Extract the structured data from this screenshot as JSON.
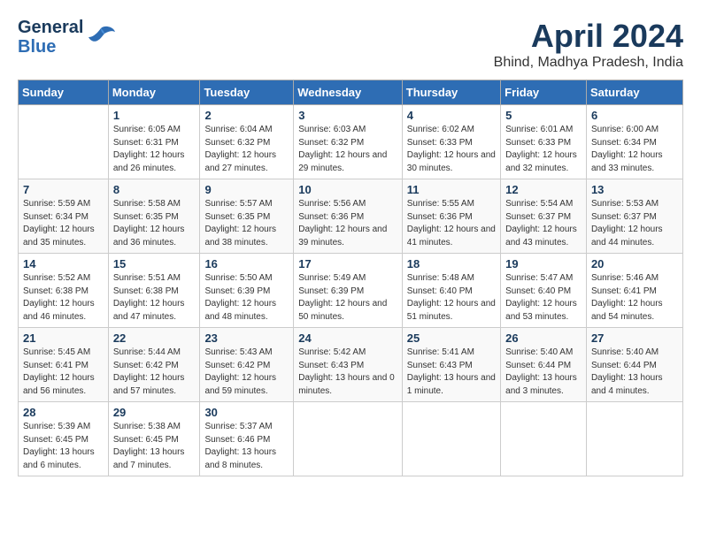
{
  "logo": {
    "line1": "General",
    "line2": "Blue"
  },
  "title": "April 2024",
  "subtitle": "Bhind, Madhya Pradesh, India",
  "days_header": [
    "Sunday",
    "Monday",
    "Tuesday",
    "Wednesday",
    "Thursday",
    "Friday",
    "Saturday"
  ],
  "weeks": [
    [
      {
        "day": "",
        "info": ""
      },
      {
        "day": "1",
        "info": "Sunrise: 6:05 AM\nSunset: 6:31 PM\nDaylight: 12 hours\nand 26 minutes."
      },
      {
        "day": "2",
        "info": "Sunrise: 6:04 AM\nSunset: 6:32 PM\nDaylight: 12 hours\nand 27 minutes."
      },
      {
        "day": "3",
        "info": "Sunrise: 6:03 AM\nSunset: 6:32 PM\nDaylight: 12 hours\nand 29 minutes."
      },
      {
        "day": "4",
        "info": "Sunrise: 6:02 AM\nSunset: 6:33 PM\nDaylight: 12 hours\nand 30 minutes."
      },
      {
        "day": "5",
        "info": "Sunrise: 6:01 AM\nSunset: 6:33 PM\nDaylight: 12 hours\nand 32 minutes."
      },
      {
        "day": "6",
        "info": "Sunrise: 6:00 AM\nSunset: 6:34 PM\nDaylight: 12 hours\nand 33 minutes."
      }
    ],
    [
      {
        "day": "7",
        "info": "Sunrise: 5:59 AM\nSunset: 6:34 PM\nDaylight: 12 hours\nand 35 minutes."
      },
      {
        "day": "8",
        "info": "Sunrise: 5:58 AM\nSunset: 6:35 PM\nDaylight: 12 hours\nand 36 minutes."
      },
      {
        "day": "9",
        "info": "Sunrise: 5:57 AM\nSunset: 6:35 PM\nDaylight: 12 hours\nand 38 minutes."
      },
      {
        "day": "10",
        "info": "Sunrise: 5:56 AM\nSunset: 6:36 PM\nDaylight: 12 hours\nand 39 minutes."
      },
      {
        "day": "11",
        "info": "Sunrise: 5:55 AM\nSunset: 6:36 PM\nDaylight: 12 hours\nand 41 minutes."
      },
      {
        "day": "12",
        "info": "Sunrise: 5:54 AM\nSunset: 6:37 PM\nDaylight: 12 hours\nand 43 minutes."
      },
      {
        "day": "13",
        "info": "Sunrise: 5:53 AM\nSunset: 6:37 PM\nDaylight: 12 hours\nand 44 minutes."
      }
    ],
    [
      {
        "day": "14",
        "info": "Sunrise: 5:52 AM\nSunset: 6:38 PM\nDaylight: 12 hours\nand 46 minutes."
      },
      {
        "day": "15",
        "info": "Sunrise: 5:51 AM\nSunset: 6:38 PM\nDaylight: 12 hours\nand 47 minutes."
      },
      {
        "day": "16",
        "info": "Sunrise: 5:50 AM\nSunset: 6:39 PM\nDaylight: 12 hours\nand 48 minutes."
      },
      {
        "day": "17",
        "info": "Sunrise: 5:49 AM\nSunset: 6:39 PM\nDaylight: 12 hours\nand 50 minutes."
      },
      {
        "day": "18",
        "info": "Sunrise: 5:48 AM\nSunset: 6:40 PM\nDaylight: 12 hours\nand 51 minutes."
      },
      {
        "day": "19",
        "info": "Sunrise: 5:47 AM\nSunset: 6:40 PM\nDaylight: 12 hours\nand 53 minutes."
      },
      {
        "day": "20",
        "info": "Sunrise: 5:46 AM\nSunset: 6:41 PM\nDaylight: 12 hours\nand 54 minutes."
      }
    ],
    [
      {
        "day": "21",
        "info": "Sunrise: 5:45 AM\nSunset: 6:41 PM\nDaylight: 12 hours\nand 56 minutes."
      },
      {
        "day": "22",
        "info": "Sunrise: 5:44 AM\nSunset: 6:42 PM\nDaylight: 12 hours\nand 57 minutes."
      },
      {
        "day": "23",
        "info": "Sunrise: 5:43 AM\nSunset: 6:42 PM\nDaylight: 12 hours\nand 59 minutes."
      },
      {
        "day": "24",
        "info": "Sunrise: 5:42 AM\nSunset: 6:43 PM\nDaylight: 13 hours\nand 0 minutes."
      },
      {
        "day": "25",
        "info": "Sunrise: 5:41 AM\nSunset: 6:43 PM\nDaylight: 13 hours\nand 1 minute."
      },
      {
        "day": "26",
        "info": "Sunrise: 5:40 AM\nSunset: 6:44 PM\nDaylight: 13 hours\nand 3 minutes."
      },
      {
        "day": "27",
        "info": "Sunrise: 5:40 AM\nSunset: 6:44 PM\nDaylight: 13 hours\nand 4 minutes."
      }
    ],
    [
      {
        "day": "28",
        "info": "Sunrise: 5:39 AM\nSunset: 6:45 PM\nDaylight: 13 hours\nand 6 minutes."
      },
      {
        "day": "29",
        "info": "Sunrise: 5:38 AM\nSunset: 6:45 PM\nDaylight: 13 hours\nand 7 minutes."
      },
      {
        "day": "30",
        "info": "Sunrise: 5:37 AM\nSunset: 6:46 PM\nDaylight: 13 hours\nand 8 minutes."
      },
      {
        "day": "",
        "info": ""
      },
      {
        "day": "",
        "info": ""
      },
      {
        "day": "",
        "info": ""
      },
      {
        "day": "",
        "info": ""
      }
    ]
  ]
}
